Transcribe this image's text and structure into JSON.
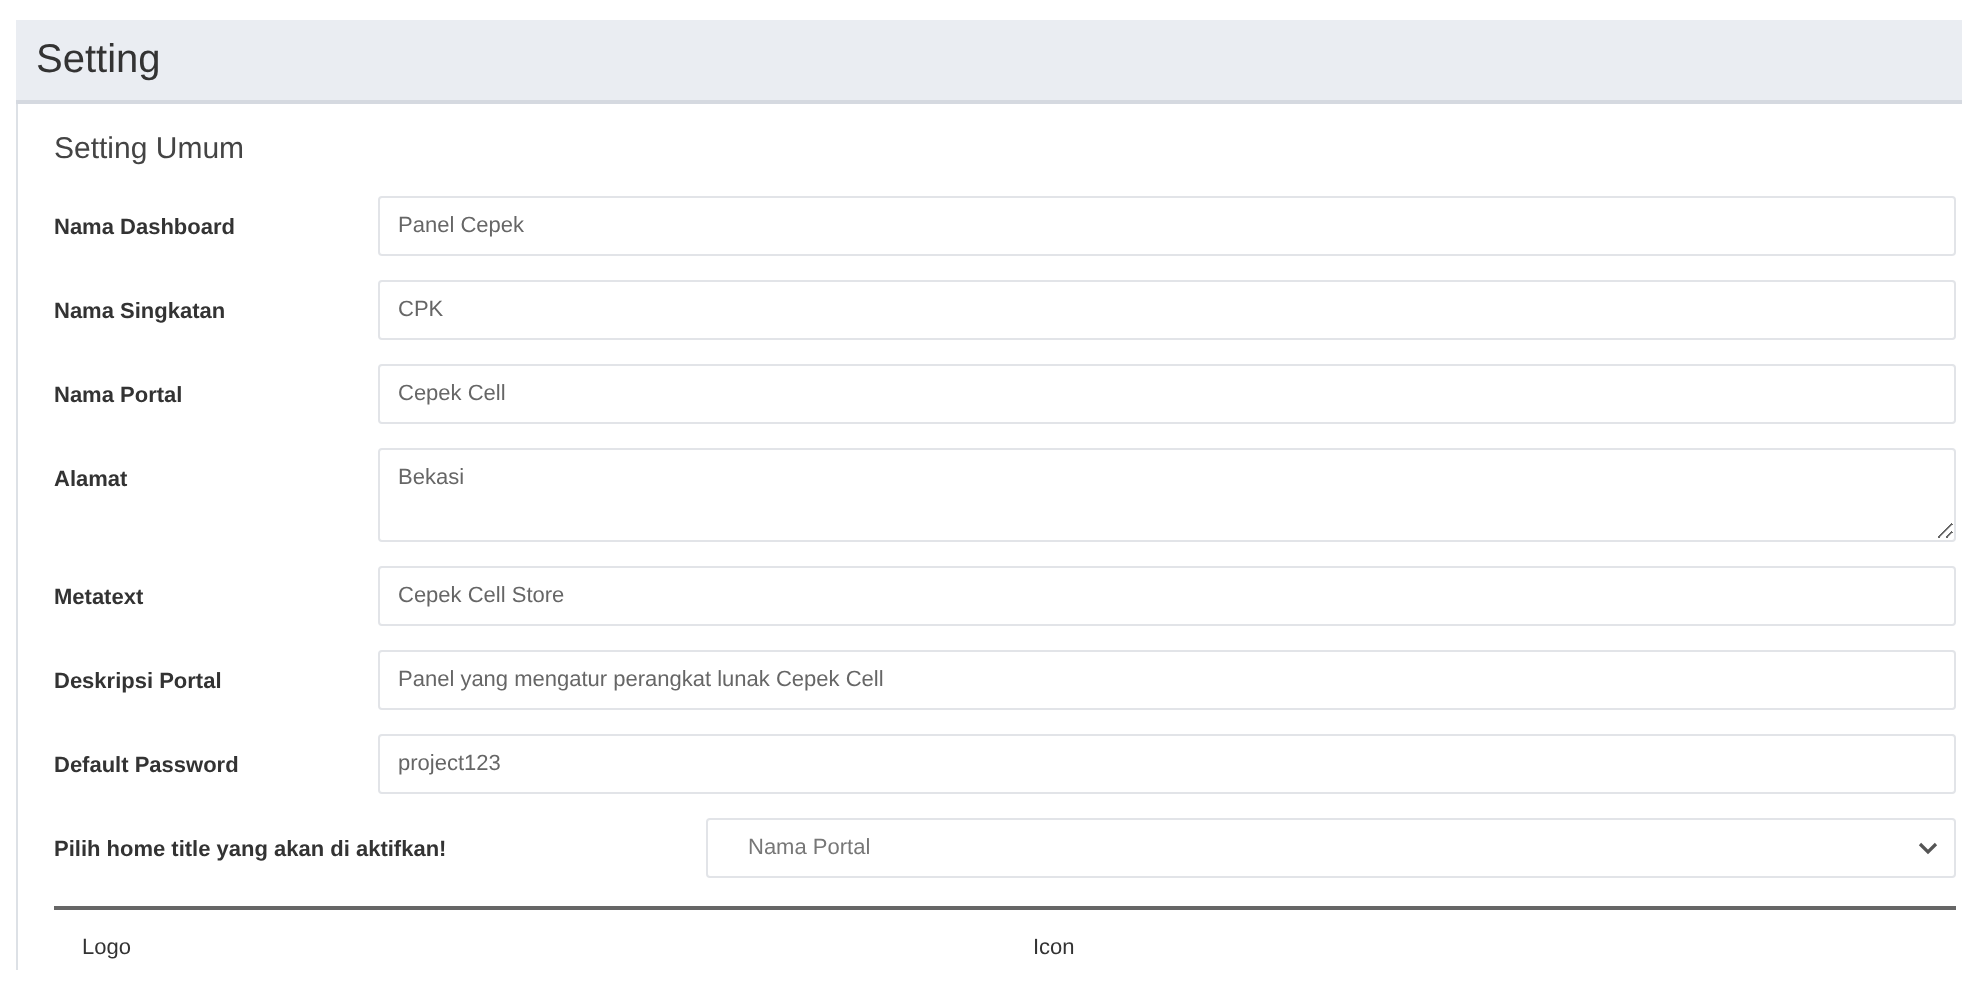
{
  "page_title": "Setting",
  "section_title": "Setting Umum",
  "fields": [
    {
      "kind": "text",
      "label": "Nama Dashboard",
      "value": "Panel Cepek"
    },
    {
      "kind": "text",
      "label": "Nama Singkatan",
      "value": "CPK"
    },
    {
      "kind": "text",
      "label": "Nama Portal",
      "value": "Cepek Cell"
    },
    {
      "kind": "textarea",
      "label": "Alamat",
      "value": "Bekasi"
    },
    {
      "kind": "text",
      "label": "Metatext",
      "value": "Cepek Cell Store"
    },
    {
      "kind": "text",
      "label": "Deskripsi Portal",
      "value": "Panel yang mengatur perangkat lunak Cepek Cell"
    },
    {
      "kind": "text",
      "label": "Default Password",
      "value": "project123"
    },
    {
      "kind": "select",
      "label": "Pilih home title yang akan di aktifkan!",
      "value": "Nama Portal"
    }
  ],
  "uploads": [
    {
      "label": "Logo"
    },
    {
      "label": "Icon"
    }
  ]
}
